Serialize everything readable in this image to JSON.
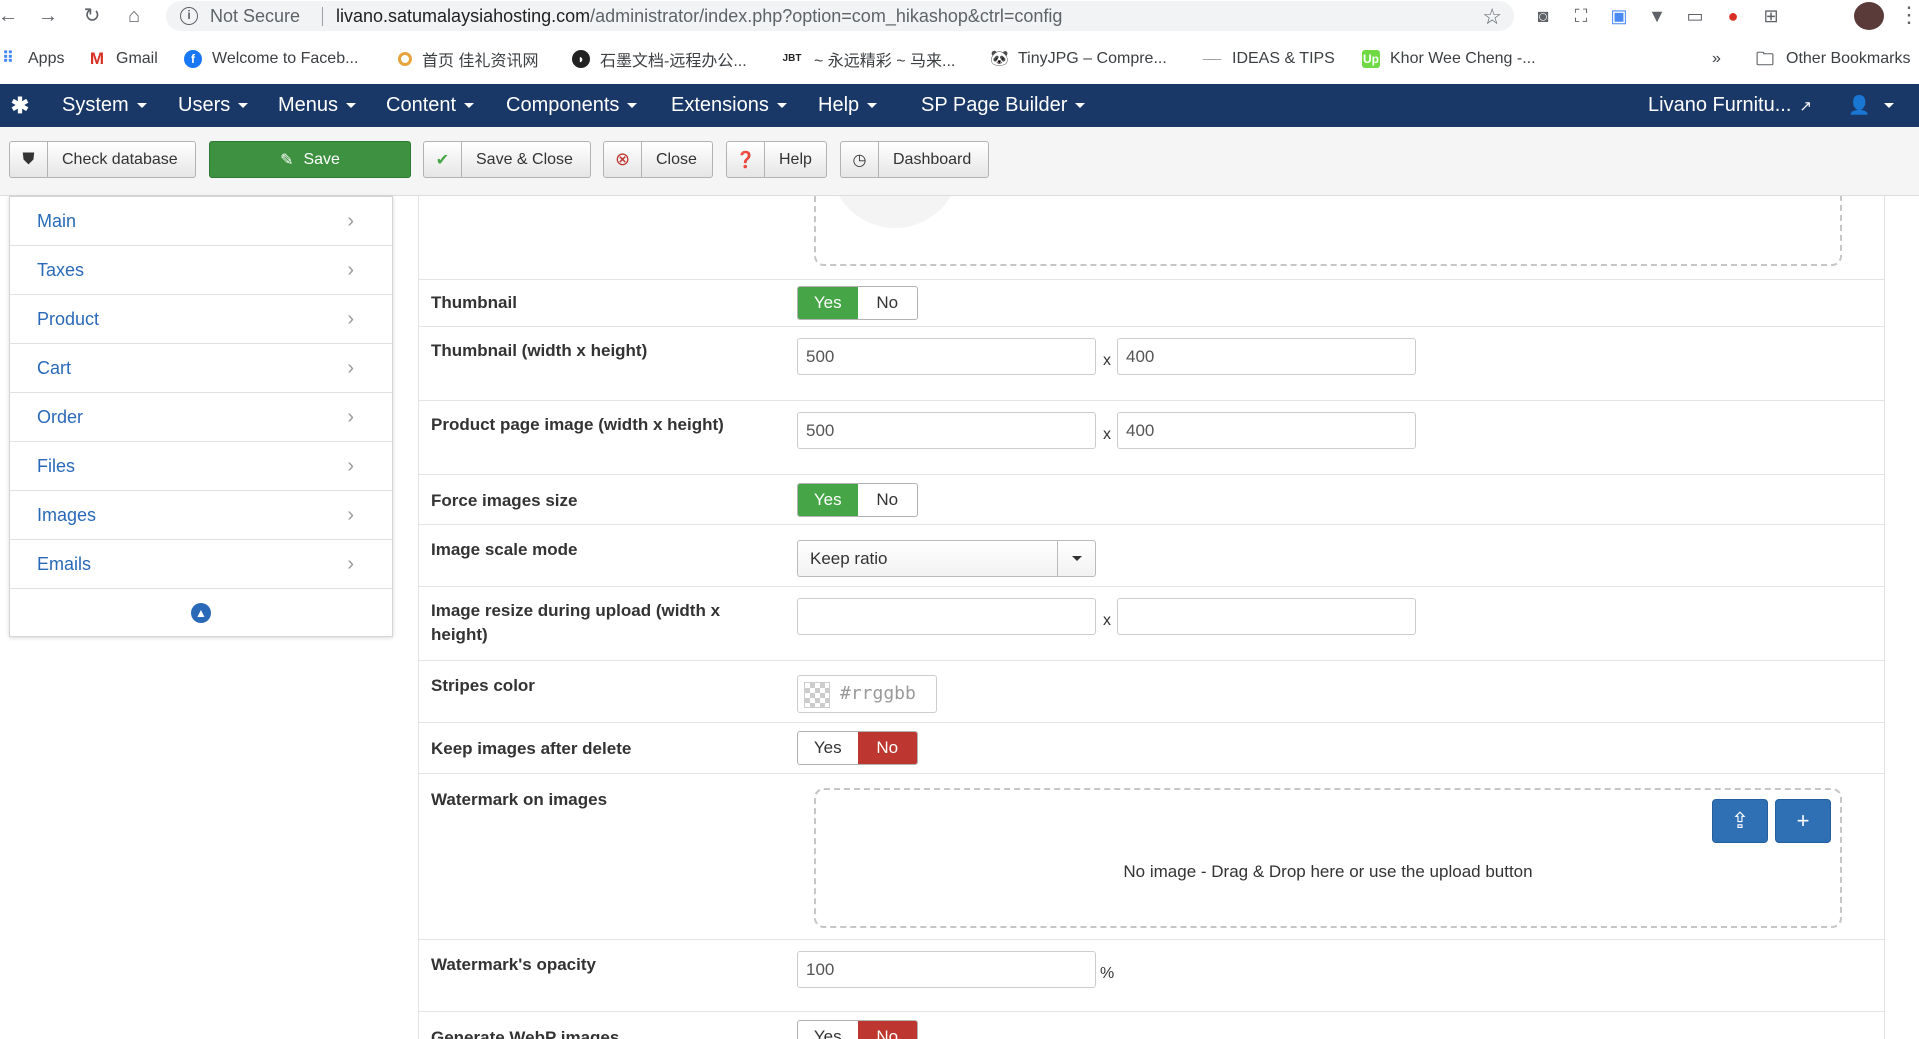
{
  "browser": {
    "security": "Not Secure",
    "url_host": "livano.satumalaysiahosting.com",
    "url_path": "/administrator/index.php?option=com_hikashop&ctrl=config"
  },
  "bookmarks": {
    "items": [
      "Apps",
      "Gmail",
      "Welcome to Faceb...",
      "首页 佳礼资讯网",
      "石墨文档-远程办公...",
      "~ 永远精彩 ~ 马来...",
      "TinyJPG – Compre...",
      "IDEAS & TIPS",
      "Khor Wee Cheng -..."
    ],
    "overflow": "»",
    "other": "Other Bookmarks"
  },
  "adminbar": {
    "menus": [
      "System",
      "Users",
      "Menus",
      "Content",
      "Components",
      "Extensions",
      "Help",
      "SP Page Builder"
    ],
    "site_link": "Livano Furnitu..."
  },
  "toolbar": {
    "check_db": "Check database",
    "save": "Save",
    "save_close": "Save & Close",
    "close": "Close",
    "help": "Help",
    "dashboard": "Dashboard"
  },
  "sidebar": {
    "items": [
      "Main",
      "Taxes",
      "Product",
      "Cart",
      "Order",
      "Files",
      "Images",
      "Emails"
    ]
  },
  "form": {
    "thumbnail": {
      "label": "Thumbnail",
      "yes": "Yes",
      "no": "No",
      "value": "Yes"
    },
    "thumbnail_size": {
      "label": "Thumbnail (width x height)",
      "width": "500",
      "height": "400",
      "sep": "x"
    },
    "product_image_size": {
      "label": "Product page image (width x height)",
      "width": "500",
      "height": "400",
      "sep": "x"
    },
    "force_size": {
      "label": "Force images size",
      "yes": "Yes",
      "no": "No",
      "value": "Yes"
    },
    "scale_mode": {
      "label": "Image scale mode",
      "value": "Keep ratio"
    },
    "resize_upload": {
      "label": "Image resize during upload (width x height)",
      "width": "",
      "height": "",
      "sep": "x"
    },
    "stripes_color": {
      "label": "Stripes color",
      "placeholder": "#rrggbb"
    },
    "keep_after_delete": {
      "label": "Keep images after delete",
      "yes": "Yes",
      "no": "No",
      "value": "No"
    },
    "watermark": {
      "label": "Watermark on images",
      "dropzone_text": "No image - Drag & Drop here or use the upload button"
    },
    "watermark_opacity": {
      "label": "Watermark's opacity",
      "value": "100",
      "unit": "%"
    },
    "webp": {
      "label": "Generate WebP images",
      "yes": "Yes",
      "no": "No",
      "value": "No"
    }
  },
  "colors": {
    "admin_nav": "#1a3867",
    "save_green": "#3d9140",
    "toggle_yes": "#46a546",
    "toggle_no": "#bd362f",
    "link_blue": "#2a69b8",
    "upload_blue": "#2f6fb3"
  }
}
